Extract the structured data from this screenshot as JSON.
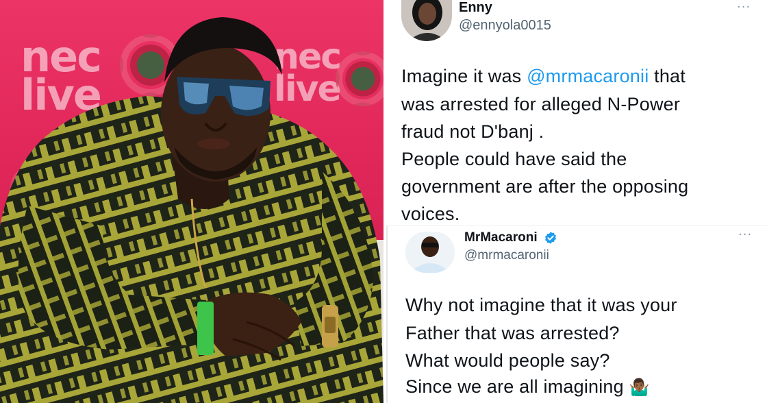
{
  "photo": {
    "backdrop_text": [
      "nec",
      "live",
      "nec",
      "live"
    ],
    "colors": {
      "backdrop": "#e32656",
      "shirt": "#1f2418",
      "stripes": "#a8a638",
      "wristband": "#3ec44a"
    }
  },
  "tweet1": {
    "author_name": "Enny",
    "author_handle": "@ennyola0015",
    "more_label": "···",
    "lines": [
      {
        "pre": "Imagine it was ",
        "mention": "@mrmacaronii",
        "post": " that"
      },
      {
        "pre": "was arrested for alleged N-Power",
        "mention": "",
        "post": ""
      },
      {
        "pre": "fraud not D'banj .",
        "mention": "",
        "post": ""
      },
      {
        "pre": "People could have said the",
        "mention": "",
        "post": ""
      },
      {
        "pre": "government are after the opposing",
        "mention": "",
        "post": ""
      },
      {
        "pre": "voices.",
        "mention": "",
        "post": ""
      }
    ]
  },
  "tweet2": {
    "author_name": "MrMacaroni",
    "author_handle": "@mrmacaronii",
    "verified_icon": "verified-badge-icon",
    "more_label": "···",
    "lines": [
      "Why not imagine that it was your",
      "Father that was arrested?",
      "What would people say?",
      "Since we are all imagining"
    ],
    "emoji": "🤷🏾‍♂️"
  }
}
